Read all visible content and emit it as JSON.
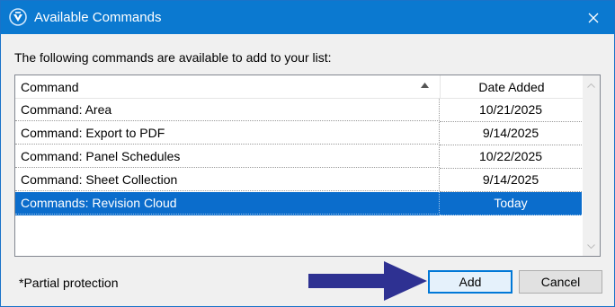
{
  "window": {
    "title": "Available Commands",
    "icon": "app-logo-icon",
    "close_icon": "close-icon"
  },
  "instruction": "The following commands are available to add to your list:",
  "table": {
    "columns": [
      {
        "label": "Command",
        "sort": "ascending"
      },
      {
        "label": "Date Added"
      }
    ],
    "rows": [
      {
        "command": "Command: Area",
        "date": "10/21/2025",
        "selected": false
      },
      {
        "command": "Command: Export to PDF",
        "date": "9/14/2025",
        "selected": false
      },
      {
        "command": "Command: Panel Schedules",
        "date": "10/22/2025",
        "selected": false
      },
      {
        "command": "Command: Sheet Collection",
        "date": "9/14/2025",
        "selected": false
      },
      {
        "command": "Commands: Revision Cloud",
        "date": "Today",
        "selected": true
      }
    ]
  },
  "footnote": "*Partial protection",
  "buttons": {
    "add": "Add",
    "cancel": "Cancel"
  },
  "colors": {
    "titlebar": "#0b79d0",
    "selection": "#0b6dcc",
    "annotation_arrow": "#2e3192"
  }
}
